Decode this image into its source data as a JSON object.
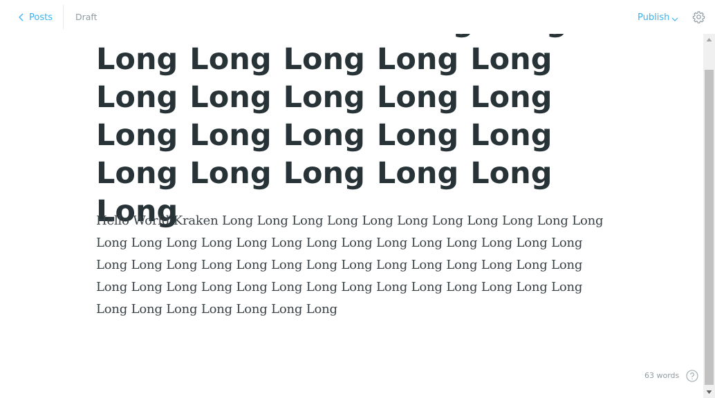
{
  "header": {
    "back_label": "Posts",
    "status": "Draft",
    "publish_label": "Publish"
  },
  "icons": {
    "back": "chevron-left-icon",
    "publish_menu": "chevron-down-icon",
    "settings": "gear-icon",
    "help": "question-circle-icon"
  },
  "colors": {
    "accent": "#3eb0ef",
    "title_text": "#283338",
    "body_text": "#3a4145",
    "muted_text": "#8e9ba3"
  },
  "post": {
    "title": "Test Post Kraken Long Long Long Long Long Long Long Long Long Long Long Long Long Long Long Long Long Long Long Long Long Long Long",
    "body": "Hello World Kraken Long Long Long Long Long Long Long Long Long Long Long Long Long Long Long Long Long Long Long Long Long Long Long Long Long Long Long Long Long Long Long Long Long Long Long Long Long Long Long Long Long Long Long Long Long Long Long Long Long Long Long Long Long Long Long Long Long Long Long Long"
  },
  "footer": {
    "word_count": "63 words"
  }
}
